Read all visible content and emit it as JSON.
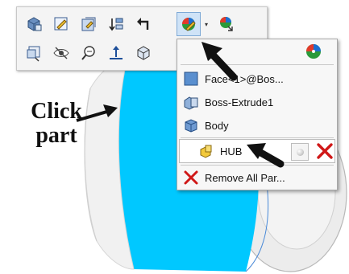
{
  "annotation": {
    "line1": "Click",
    "line2": "part"
  },
  "toolbar": {
    "row1": [
      {
        "icon": "view-orientation-icon"
      },
      {
        "icon": "edit-sketch-icon"
      },
      {
        "icon": "edit-feature-icon"
      },
      {
        "icon": "rollback-icon"
      },
      {
        "icon": "go-back-icon"
      },
      {
        "icon": "appearance-icon",
        "active": true
      },
      {
        "icon": "edit-appearance-icon"
      }
    ],
    "row2": [
      {
        "icon": "zoom-to-selection-icon"
      },
      {
        "icon": "hide-icon"
      },
      {
        "icon": "zoom-icon"
      },
      {
        "icon": "normal-to-icon"
      },
      {
        "icon": "display-style-icon"
      }
    ]
  },
  "menu": {
    "items": [
      {
        "label": "Face<1>@Bos...",
        "icon": "face-icon"
      },
      {
        "label": "Boss-Extrude1",
        "icon": "feature-icon"
      },
      {
        "label": "Body",
        "icon": "body-icon"
      },
      {
        "label": "HUB",
        "icon": "part-icon"
      },
      {
        "label": "Remove All Par...",
        "icon": "remove-icon"
      }
    ]
  },
  "colors": {
    "part_face": "#00c8ff",
    "part_edge": "#3a7fd0",
    "remove_red": "#d01818",
    "selection_blue": "#cfe3f7"
  }
}
